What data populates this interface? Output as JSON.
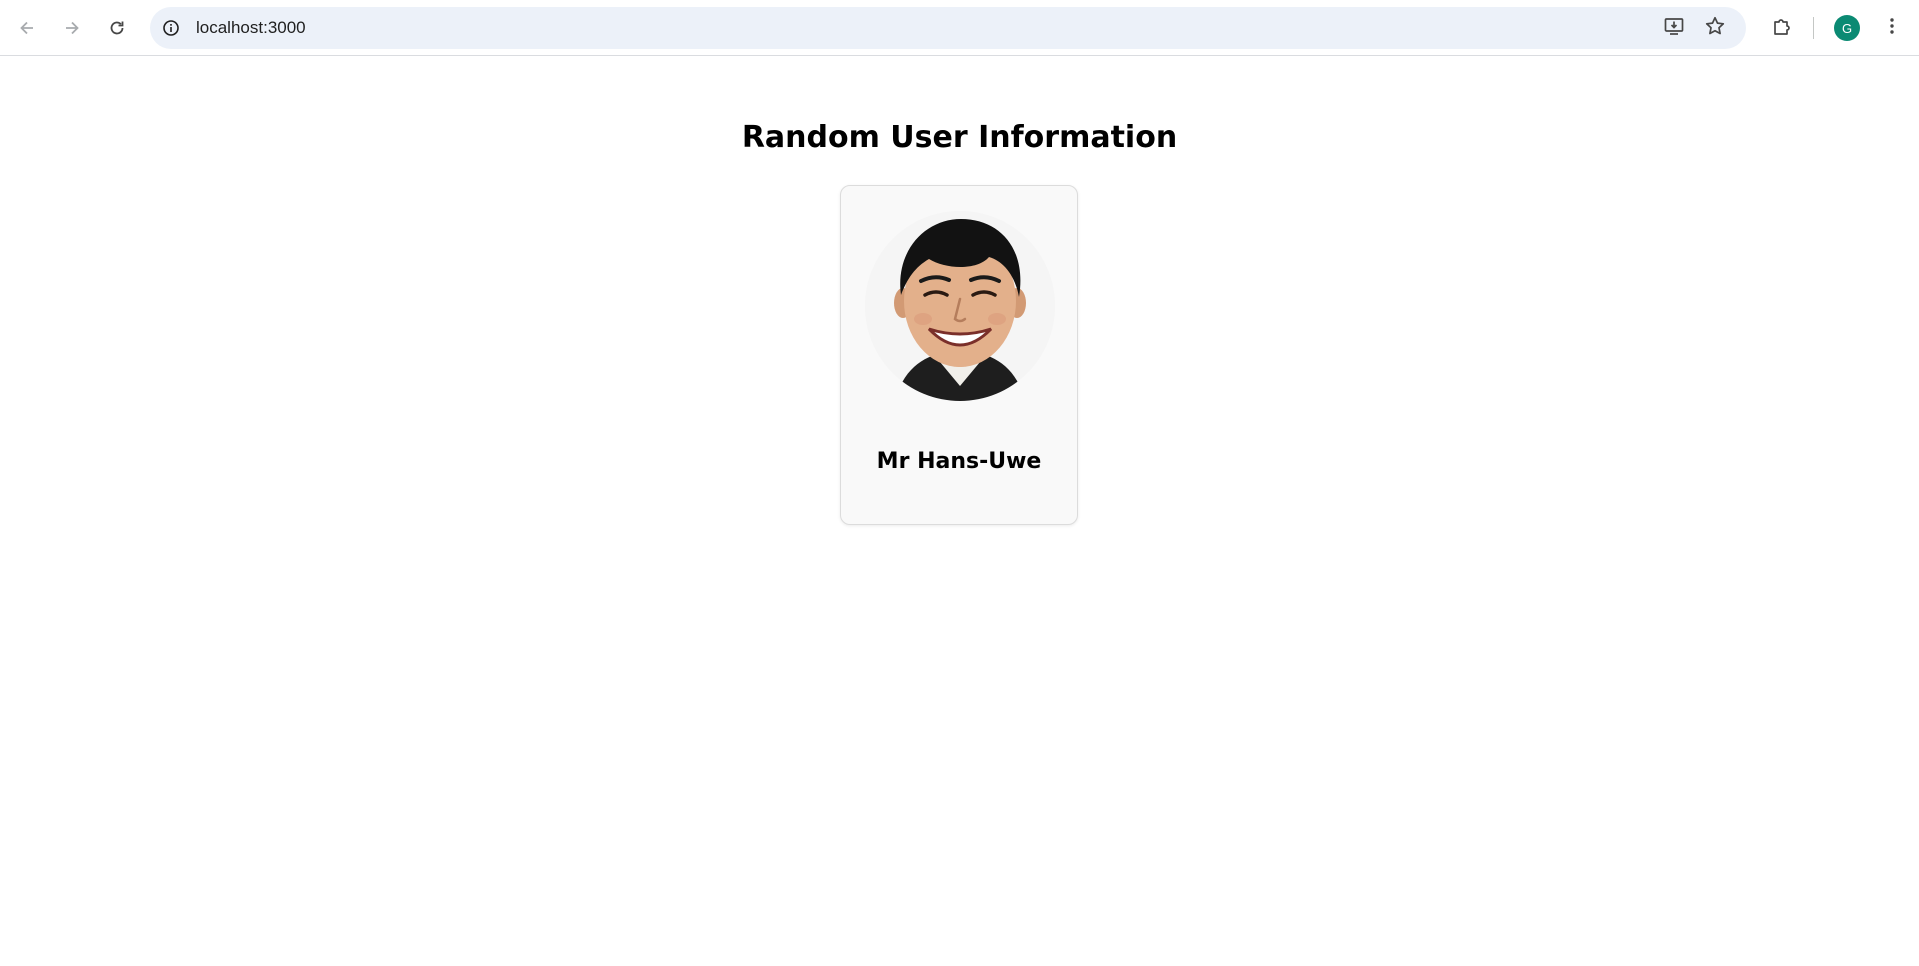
{
  "browser": {
    "url": "localhost:3000",
    "profile_initial": "G",
    "profile_color": "#0b8a73",
    "icons": {
      "back": "arrow-left-icon",
      "forward": "arrow-right-icon",
      "reload": "reload-icon",
      "site_info": "info-icon",
      "install": "install-app-icon",
      "bookmark": "star-icon",
      "extensions": "puzzle-icon",
      "menu": "kebab-menu-icon"
    }
  },
  "page": {
    "title": "Random User Information"
  },
  "user": {
    "name": "Mr Hans-Uwe",
    "photo": "portrait-photo"
  }
}
